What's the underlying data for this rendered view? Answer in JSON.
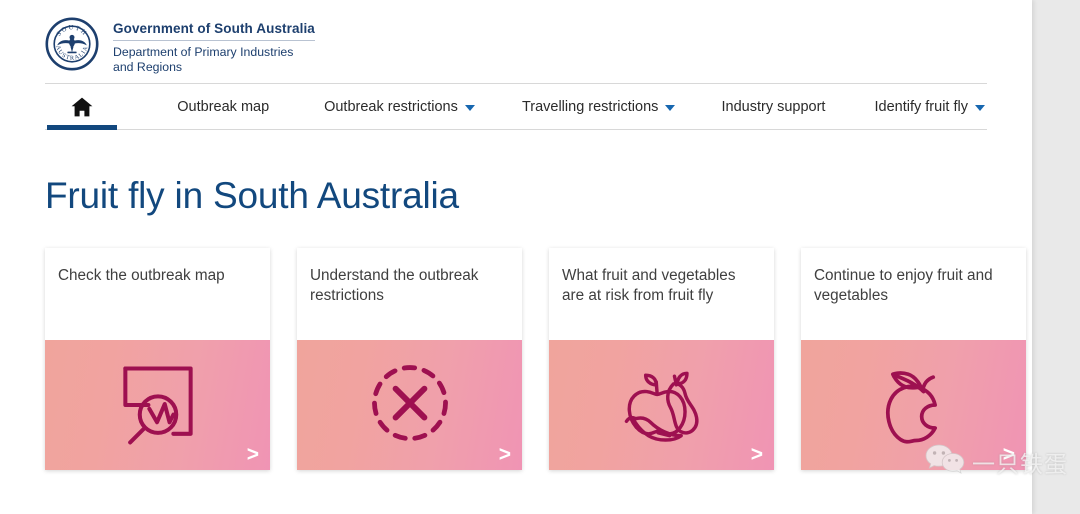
{
  "header": {
    "crest_icon": "south-australia-state-crest",
    "crest_text_top": "SOUTH",
    "crest_text_bottom": "AUSTRALIA",
    "brand_title": "Government of South Australia",
    "brand_subtitle_line1": "Department of Primary Industries",
    "brand_subtitle_line2": "and Regions"
  },
  "nav": {
    "home": {
      "label": "Home",
      "icon": "home-icon",
      "active": true
    },
    "items": [
      {
        "label": "Outbreak map",
        "has_dropdown": false
      },
      {
        "label": "Outbreak restrictions",
        "has_dropdown": true
      },
      {
        "label": "Travelling restrictions",
        "has_dropdown": true
      },
      {
        "label": "Industry support",
        "has_dropdown": false
      },
      {
        "label": "Identify fruit fly",
        "has_dropdown": true
      }
    ],
    "active_indicator_color": "#12487e",
    "caret_color": "#1767b0"
  },
  "main": {
    "page_title": "Fruit fly in South Australia",
    "page_title_color": "#12487e",
    "cards": [
      {
        "title": "Check the outbreak map",
        "icon": "map-magnifier-icon",
        "arrow": ">"
      },
      {
        "title": "Understand the outbreak restrictions",
        "icon": "dashed-circle-cross-icon",
        "arrow": ">"
      },
      {
        "title": "What fruit and vegetables are at risk from fruit fly",
        "icon": "apple-pear-chilli-icon",
        "arrow": ">"
      },
      {
        "title": "Continue to enjoy fruit and vegetables",
        "icon": "bitten-apple-icon",
        "arrow": ">"
      }
    ],
    "card_art_gradient_from": "#f0a49c",
    "card_art_gradient_to": "#f094b4",
    "card_icon_color": "#9e1050"
  },
  "watermark": {
    "icon": "wechat-icon",
    "text": "一只铁蛋"
  }
}
